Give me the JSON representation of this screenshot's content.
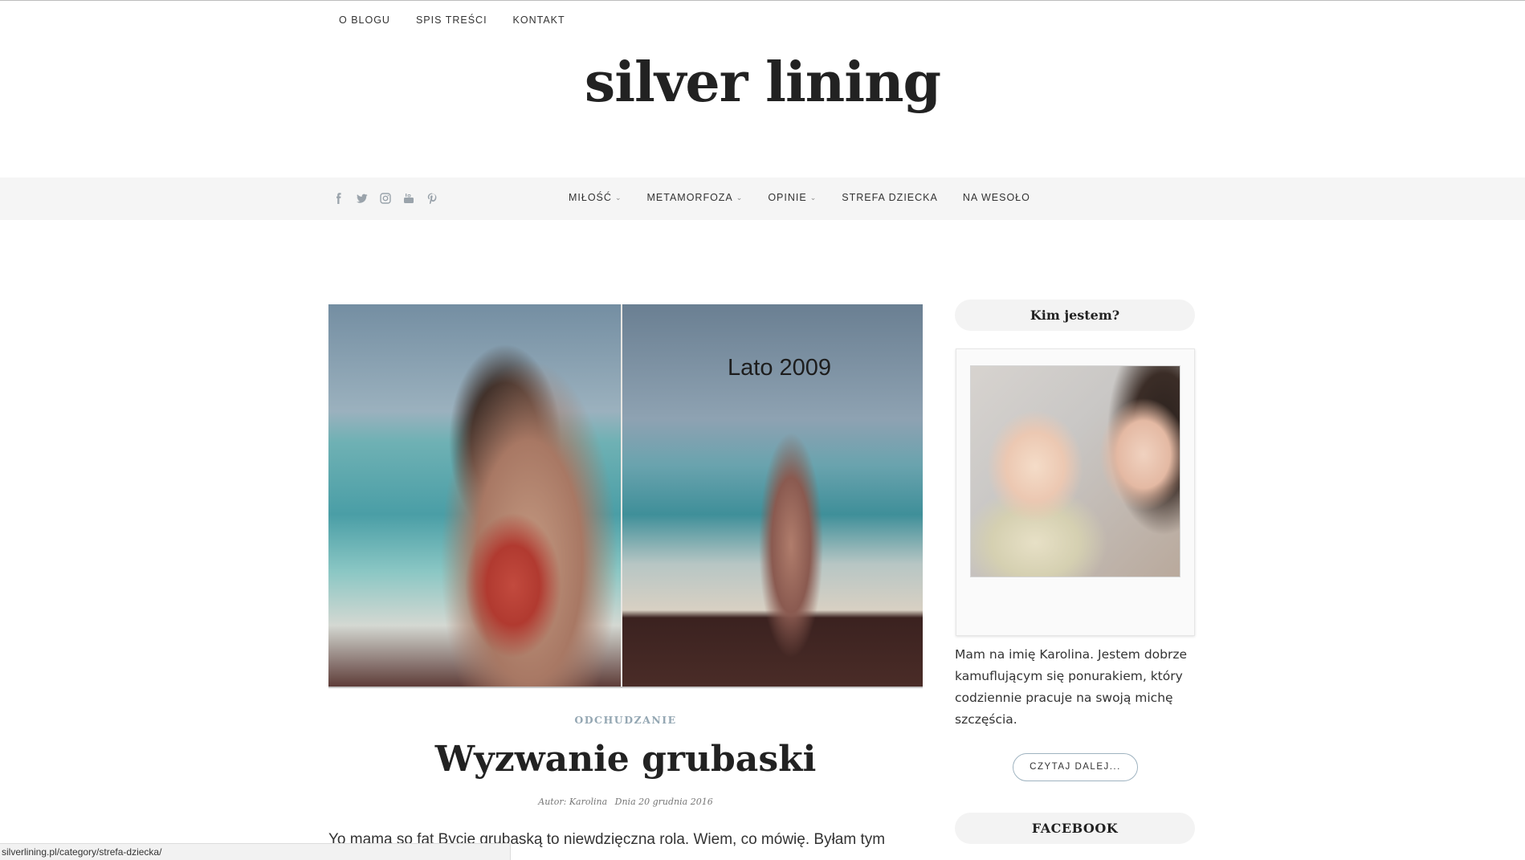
{
  "top_nav": {
    "items": [
      "O BLOGU",
      "SPIS TREŚCI",
      "KONTAKT"
    ]
  },
  "site": {
    "title": "silver lining"
  },
  "social_icons": [
    "facebook-icon",
    "twitter-icon",
    "instagram-icon",
    "youtube-icon",
    "pinterest-icon"
  ],
  "main_nav": {
    "items": [
      {
        "label": "MIŁOŚĆ",
        "has_dropdown": true
      },
      {
        "label": "METAMORFOZA",
        "has_dropdown": true
      },
      {
        "label": "OPINIE",
        "has_dropdown": true
      },
      {
        "label": "STREFA DZIECKA",
        "has_dropdown": false
      },
      {
        "label": "NA WESOŁO",
        "has_dropdown": false
      }
    ]
  },
  "post": {
    "image_caption": "Lato 2009",
    "category": "ODCHUDZANIE",
    "title": "Wyzwanie grubaski",
    "author": "Autor: Karolina",
    "date": "Dnia 20 grudnia 2016",
    "excerpt": "Yo mama so fat Bycie grubaską to niewdzięczna rola.  Wiem, co mówię. Byłam tym"
  },
  "sidebar": {
    "about_title": "Kim jestem?",
    "about_text": "Mam na imię Karolina. Jestem dobrze kamuflującym się ponurakiem, który codziennie pracuje na swoją michę szczęścia.",
    "read_more": "CZYTAJ DALEJ...",
    "facebook_title": "FACEBOOK"
  },
  "status_bar": {
    "url": "silverlining.pl/category/strefa-dziecka/"
  },
  "colors": {
    "nav_bg": "#f5f5f5",
    "accent": "#94a7b3",
    "text": "#222222"
  }
}
